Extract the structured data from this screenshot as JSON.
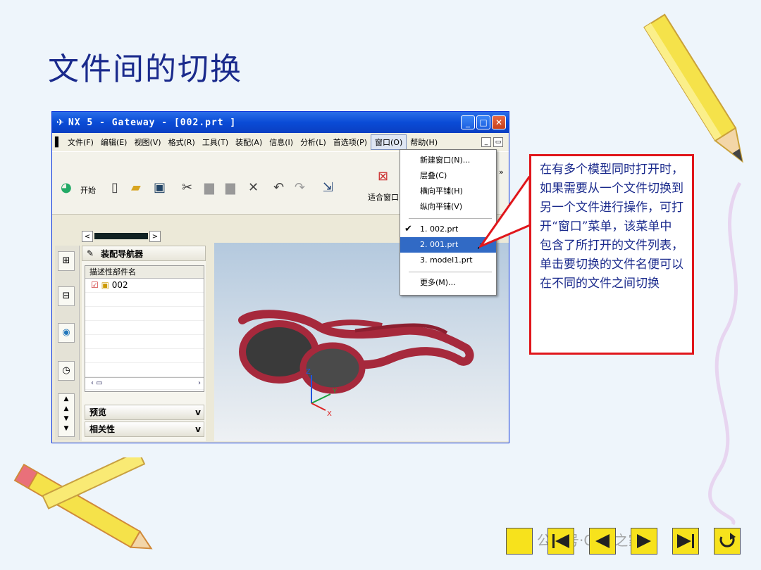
{
  "slide": {
    "title": "文件间的切换"
  },
  "window": {
    "title": "NX 5 - Gateway - [002.prt  ]",
    "menu": [
      "文件(F)",
      "编辑(E)",
      "视图(V)",
      "格式(R)",
      "工具(T)",
      "装配(A)",
      "信息(I)",
      "分析(L)",
      "首选项(P)",
      "窗口(O)",
      "帮助(H)"
    ],
    "toolbar": {
      "start_label": "开始",
      "fit_window_label": "适合窗口"
    },
    "navigator": {
      "title": "装配导航器",
      "column": "描述性部件名",
      "node": "002",
      "preview": "预览",
      "dependency": "相关性"
    },
    "axes": {
      "z": "Z",
      "y": "Y",
      "x": "X"
    }
  },
  "window_menu": {
    "items": [
      "新建窗口(N)...",
      "层叠(C)",
      "横向平铺(H)",
      "纵向平铺(V)"
    ],
    "files": [
      "1. 002.prt",
      "2. 001.prt",
      "3. model1.prt"
    ],
    "checked_file": "1. 002.prt",
    "selected_file": "2. 001.prt",
    "more": "更多(M)..."
  },
  "callout": {
    "text": "在有多个模型同时打开时，如果需要从一个文件切换到另一个文件进行操作，可打开“窗口”菜单，该菜单中包含了所打开的文件列表，单击要切换的文件名便可以在不同的文件之间切换"
  },
  "watermark": "公众号·CAD之家",
  "colors": {
    "title": "#1a2a8c",
    "callout_border": "#e0161b",
    "nav_button": "#f7e21c",
    "selection": "#316ac5"
  }
}
